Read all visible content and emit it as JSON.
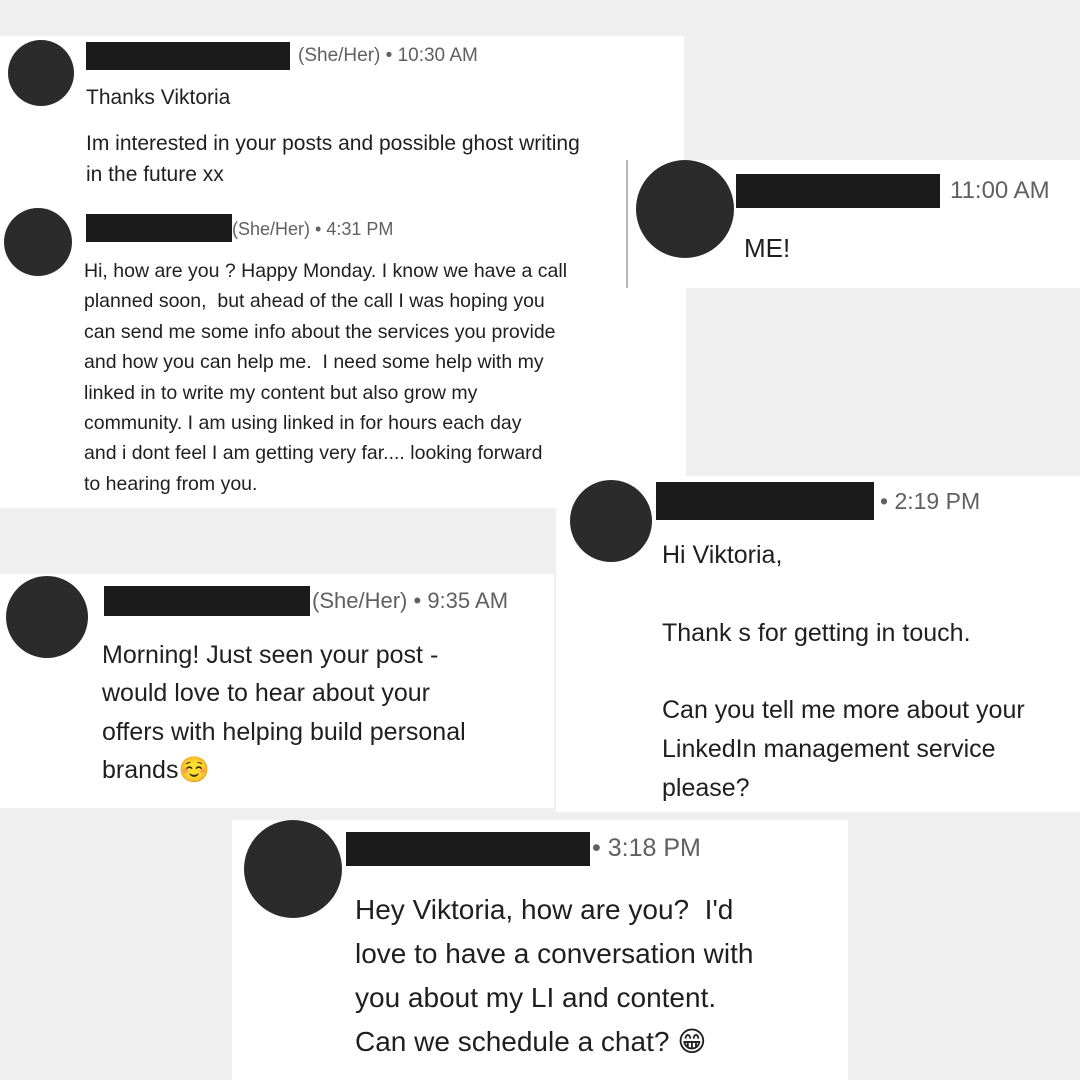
{
  "messages": [
    {
      "pronouns": "(She/Her)",
      "sep": "•",
      "time": "10:30 AM",
      "lines": [
        "Thanks Viktoria",
        "Im interested in your posts and possible ghost writing",
        "in the future xx"
      ]
    },
    {
      "pronouns": "(She/Her)",
      "sep": "•",
      "time": "4:31 PM",
      "text": "Hi, how are you ? Happy Monday. I know we have a call\nplanned soon,  but ahead of the call I was hoping you\ncan send me some info about the services you provide\nand how you can help me.  I need some help with my\nlinked in to write my content but also grow my\ncommunity. I am using linked in for hours each day\nand i dont feel I am getting very far.... looking forward\nto hearing from you."
    },
    {
      "time": "11:00 AM",
      "text": "ME!"
    },
    {
      "sep": "•",
      "time": "2:19 PM",
      "text": "Hi Viktoria,\n\nThank s for getting in touch.\n\nCan you tell me more about your\nLinkedIn management service\nplease?"
    },
    {
      "pronouns": "(She/Her)",
      "sep": "•",
      "time": "9:35 AM",
      "text": "Morning! Just seen your post -\nwould love to hear about your\noffers with helping build personal\nbrands☺️"
    },
    {
      "sep": "•",
      "time": "3:18 PM",
      "text": "Hey Viktoria, how are you?  I'd\nlove to have a conversation with\nyou about my LI and content.\nCan we schedule a chat? 😁"
    }
  ]
}
